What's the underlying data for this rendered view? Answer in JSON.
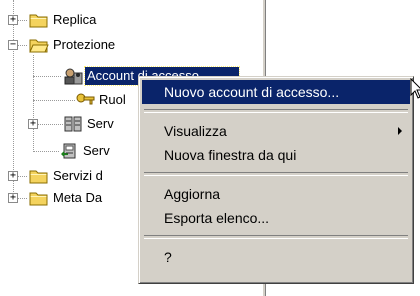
{
  "tree": {
    "items": [
      {
        "label": "Replica",
        "icon": "folder-icon",
        "expander": "+"
      },
      {
        "label": "Protezione",
        "icon": "folder-open-icon",
        "expander": "−"
      },
      {
        "label": "Account di accesso",
        "icon": "login-accounts-icon"
      },
      {
        "label": "Ruoli server",
        "icon": "key-icon"
      },
      {
        "label": "Server collegati",
        "icon": "database-servers-icon",
        "expander": "+"
      },
      {
        "label": "Server remoti",
        "icon": "remote-server-icon"
      },
      {
        "label": "Servizi di supporto",
        "icon": "folder-icon",
        "expander": "+"
      },
      {
        "label": "Meta Data Services",
        "icon": "folder-icon",
        "expander": "+"
      }
    ],
    "visible_labels": [
      "Replica",
      "Protezione",
      "Account di accesso",
      "Ruol",
      "Serv",
      "Serv",
      "Servizi d",
      "Meta Da"
    ]
  },
  "context_menu": {
    "items": [
      {
        "label": "Nuovo account di accesso...",
        "highlighted": true
      },
      {
        "label": "Visualizza",
        "submenu": true
      },
      {
        "label": "Nuova finestra da qui"
      },
      {
        "label": "Aggiorna"
      },
      {
        "label": "Esporta elenco..."
      },
      {
        "label": "?"
      }
    ]
  },
  "colors": {
    "selection": "#0a246a",
    "menu_face": "#d4d0c8",
    "folder_yellow": "#f4d35e"
  }
}
